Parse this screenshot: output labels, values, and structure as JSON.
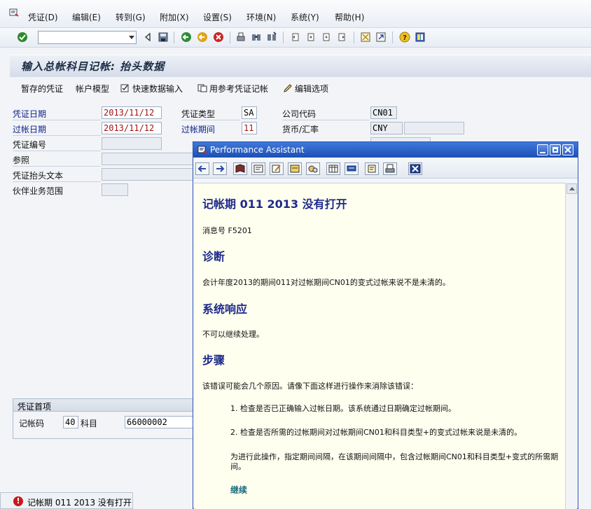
{
  "menu": {
    "items": [
      "凭证(D)",
      "编辑(E)",
      "转到(G)",
      "附加(X)",
      "设置(S)",
      "环境(N)",
      "系统(Y)",
      "帮助(H)"
    ]
  },
  "toolbar": {
    "command_field": ""
  },
  "screen": {
    "title": "输入总帐科目记帐: 抬头数据"
  },
  "app_toolbar": {
    "parked_docs": "暂存的凭证",
    "account_model": "帐户模型",
    "fast_entry": "快速数据输入",
    "post_with_ref": "用参考凭证记帐",
    "edit_options": "编辑选项"
  },
  "header": {
    "doc_date_label": "凭证日期",
    "doc_date": "2013/11/12",
    "posting_date_label": "过帐日期",
    "posting_date": "2013/11/12",
    "doc_number_label": "凭证编号",
    "doc_number": "",
    "reference_label": "参照",
    "reference": "",
    "header_text_label": "凭证抬头文本",
    "header_text": "",
    "trading_partner_label": "伙伴业务范围",
    "trading_partner": "",
    "doc_type_label": "凭证类型",
    "doc_type": "SA",
    "period_label": "过帐期间",
    "period": "11",
    "company_code_label": "公司代码",
    "company_code": "CN01",
    "currency_label": "货币/汇率",
    "currency": "CNY",
    "exchange_rate": ""
  },
  "first_item": {
    "group_title": "凭证首项",
    "posting_key_label": "记帐码",
    "posting_key": "40",
    "account_label": "科目",
    "account": "66000002"
  },
  "status": {
    "type": "error",
    "message": "记帐期 011 2013 没有打开"
  },
  "performance_assistant": {
    "window_title": "Performance Assistant",
    "heading": "记帐期  011 2013 没有打开",
    "message_number": "消息号  F5201",
    "diagnosis_title": "诊断",
    "diagnosis_text": "会计年度2013的期间011对过帐期间CN01的变式过帐来说不是未清的。",
    "system_response_title": "系统响应",
    "system_response_text": "不可以继续处理。",
    "procedure_title": "步骤",
    "procedure_text": "该错误可能会几个原因。请像下面这样进行操作来消除该错误：",
    "steps": [
      "1. 检查是否已正确输入过帐日期。该系统通过日期确定过帐期间。",
      "2. 检查是否所需的过帐期间对过帐期间CN01和科目类型+的变式过帐来说是未清的。",
      "为进行此操作，指定期间间隔，在该期间间隔中，包含过帐期间CN01和科目类型+变式的所需期间。"
    ],
    "continue_link": "继续"
  }
}
